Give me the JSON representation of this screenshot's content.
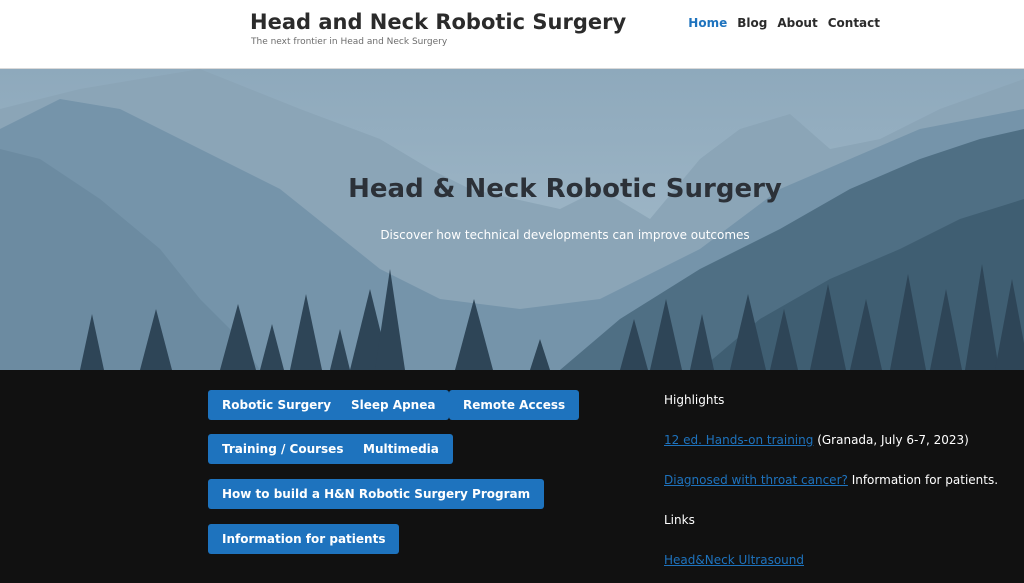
{
  "header": {
    "site_title": "Head and Neck Robotic Surgery",
    "tagline": "The next frontier in Head and Neck Surgery",
    "nav": [
      "Home",
      "Blog",
      "About",
      "Contact"
    ],
    "active_nav": "Home"
  },
  "hero": {
    "title": "Head & Neck Robotic Surgery",
    "subtitle": "Discover how technical developments can improve outcomes"
  },
  "buttons": {
    "robotic_surgery": "Robotic Surgery",
    "sleep_apnea": "Sleep Apnea",
    "remote_access": "Remote Access",
    "training_courses": "Training / Courses",
    "multimedia": "Multimedia",
    "build_program": "How to build a H&N Robotic Surgery Program",
    "information_patients": "Information for patients"
  },
  "sidebar": {
    "highlights_heading": "Highlights",
    "training_link": "12 ed. Hands-on training",
    "training_text": " (Granada, July 6-7, 2023)",
    "diagnosed_link": "Diagnosed with throat cancer?",
    "diagnosed_text": " Information for patients.",
    "links_heading": "Links",
    "ultrasound_link": "Head&Neck Ultrasound"
  },
  "colors": {
    "accent": "#1e73be",
    "footer_bg": "#111111",
    "header_bg": "#ffffff"
  }
}
